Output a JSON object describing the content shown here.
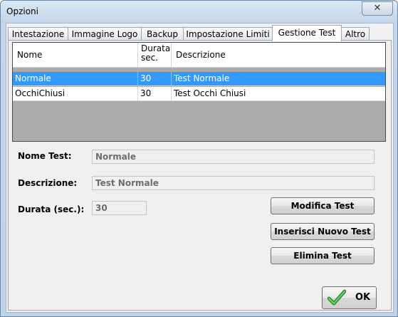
{
  "window": {
    "title": "Opzioni",
    "close_glyph": "✕"
  },
  "tabs": [
    {
      "label": "Intestazione",
      "active": false
    },
    {
      "label": "Immagine Logo",
      "active": false
    },
    {
      "label": "Backup",
      "active": false
    },
    {
      "label": "Impostazione Limiti",
      "active": false
    },
    {
      "label": "Gestione Test",
      "active": true
    },
    {
      "label": "Altro",
      "active": false
    }
  ],
  "grid": {
    "columns": [
      {
        "label": "Nome"
      },
      {
        "label": "Durata\nsec."
      },
      {
        "label": "Descrizione"
      }
    ],
    "rows": [
      {
        "nome": "Normale",
        "durata": "30",
        "descrizione": "Test Normale",
        "selected": true
      },
      {
        "nome": "OcchiChiusi",
        "durata": "30",
        "descrizione": "Test Occhi Chiusi",
        "selected": false
      }
    ]
  },
  "form": {
    "nome_label": "Nome Test:",
    "nome_value": "Normale",
    "descrizione_label": "Descrizione:",
    "descrizione_value": "Test Normale",
    "durata_label": "Durata (sec.):",
    "durata_value": "30"
  },
  "buttons": {
    "modifica": "Modifica Test",
    "inserisci": "Inserisci Nuovo Test",
    "elimina": "Elimina Test",
    "ok": "OK"
  },
  "colors": {
    "selection": "#3399ff",
    "ok_check": "#3aa33a"
  },
  "icons": {
    "ok": "checkmark-icon",
    "close": "close-icon"
  }
}
